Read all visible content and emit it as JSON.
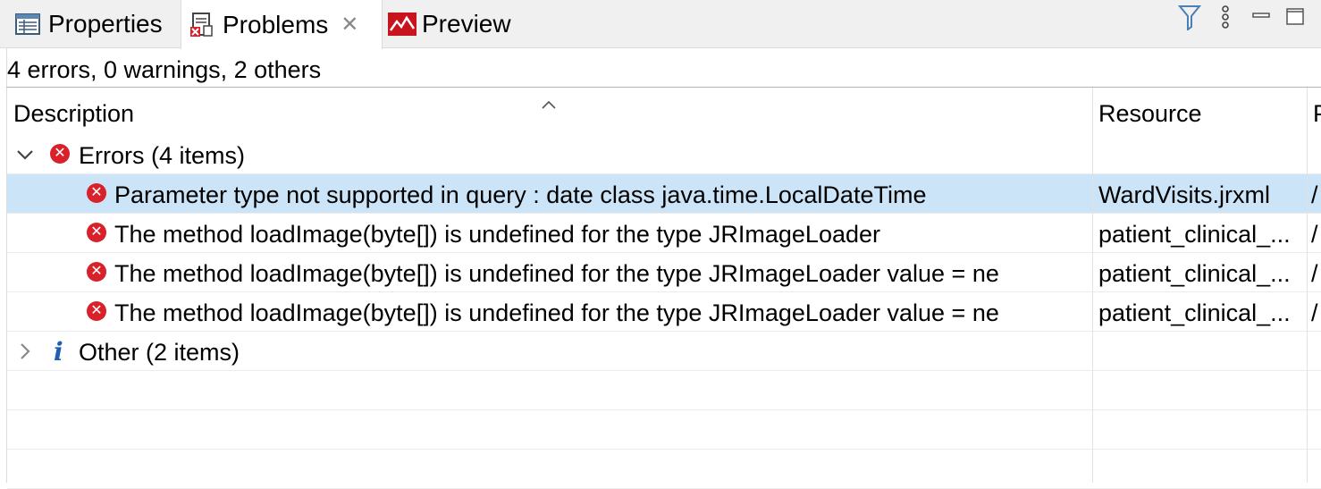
{
  "tabs": [
    {
      "label": "Properties",
      "icon": "properties-icon"
    },
    {
      "label": "Problems",
      "icon": "problems-icon",
      "close": "✕"
    },
    {
      "label": "Preview",
      "icon": "preview-icon"
    }
  ],
  "toolbar_icons": [
    "filter-icon",
    "view-menu-icon",
    "minimize-icon",
    "maximize-icon"
  ],
  "summary": "4 errors, 0 warnings, 2 others",
  "columns": {
    "description": "Description",
    "resource": "Resource",
    "path": "P"
  },
  "groups": {
    "errors": {
      "label": "Errors (4 items)"
    },
    "other": {
      "label": "Other (2 items)"
    }
  },
  "rows": [
    {
      "description": "Parameter type not supported in query : date class java.time.LocalDateTime",
      "resource": "WardVisits.jrxml",
      "path": "/"
    },
    {
      "description": "The method loadImage(byte[]) is undefined for the type JRImageLoader",
      "resource": "patient_clinical_...",
      "path": "/"
    },
    {
      "description": "The method loadImage(byte[]) is undefined for the type JRImageLoader value = ne",
      "resource": "patient_clinical_...",
      "path": "/"
    },
    {
      "description": "The method loadImage(byte[]) is undefined for the type JRImageLoader value = ne",
      "resource": "patient_clinical_...",
      "path": "/"
    }
  ],
  "colors": {
    "selection": "#cce4f7",
    "error": "#d8212b",
    "info": "#1e5fb3"
  }
}
